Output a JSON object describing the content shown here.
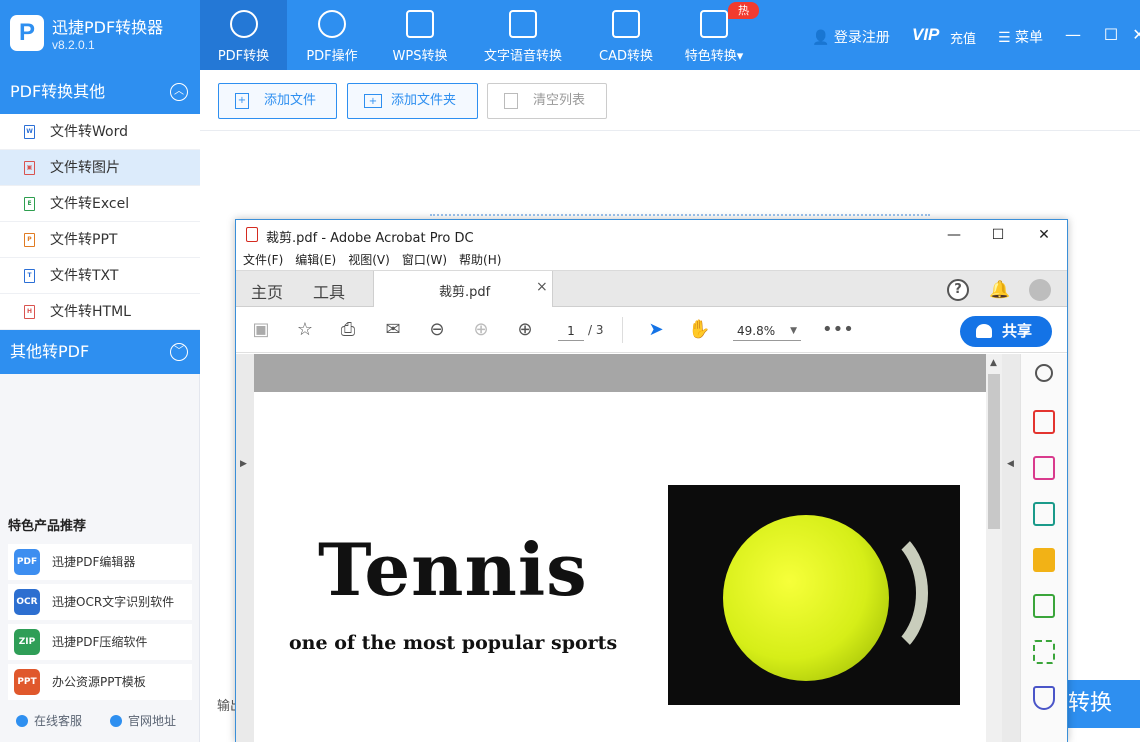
{
  "app": {
    "name": "迅捷PDF转换器",
    "version": "v8.2.0.1",
    "logo_letter": "P"
  },
  "nav": {
    "items": [
      {
        "label": "PDF转换",
        "active": true
      },
      {
        "label": "PDF操作"
      },
      {
        "label": "WPS转换"
      },
      {
        "label": "文字语音转换"
      },
      {
        "label": "CAD转换"
      },
      {
        "label": "特色转换▾"
      }
    ],
    "hot_badge": "热"
  },
  "topright": {
    "login": "登录注册",
    "vip": "VIP",
    "vip_sub": "充值",
    "menu": "菜单",
    "min": "—",
    "max": "☐",
    "close": "✕"
  },
  "sidebar": {
    "section1": "PDF转换其他",
    "items": [
      {
        "label": "文件转Word",
        "icon": "W",
        "color": "#2b6fd6"
      },
      {
        "label": "文件转图片",
        "icon": "▣",
        "color": "#d9534f",
        "selected": true
      },
      {
        "label": "文件转Excel",
        "icon": "E",
        "color": "#2e9e4f"
      },
      {
        "label": "文件转PPT",
        "icon": "P",
        "color": "#e07b22"
      },
      {
        "label": "文件转TXT",
        "icon": "T",
        "color": "#2b6fd6"
      },
      {
        "label": "文件转HTML",
        "icon": "H",
        "color": "#d9534f"
      }
    ],
    "section2": "其他转PDF",
    "promo_title": "特色产品推荐",
    "promos": [
      {
        "label": "迅捷PDF编辑器",
        "icon": "PDF",
        "color": "#3d8ef0"
      },
      {
        "label": "迅捷OCR文字识别软件",
        "icon": "OCR",
        "color": "#2d6fd0"
      },
      {
        "label": "迅捷PDF压缩软件",
        "icon": "ZIP",
        "color": "#2f9e57"
      },
      {
        "label": "办公资源PPT模板",
        "icon": "PPT",
        "color": "#e0582c"
      }
    ],
    "footer": {
      "service": "在线客服",
      "website": "官网地址"
    }
  },
  "toolbar": {
    "add_file": "添加文件",
    "add_folder": "添加文件夹",
    "clear": "清空列表"
  },
  "main": {
    "output_label": "输出",
    "convert": "转换"
  },
  "acrobat": {
    "title": "裁剪.pdf - Adobe Acrobat Pro DC",
    "menu": [
      "文件(F)",
      "编辑(E)",
      "视图(V)",
      "窗口(W)",
      "帮助(H)"
    ],
    "tabs": {
      "home": "主页",
      "tools": "工具",
      "file": "裁剪.pdf",
      "close": "×"
    },
    "page_current": "1",
    "page_total": "/ 3",
    "zoom": "49.8%",
    "share": "共享",
    "help": "?",
    "doc": {
      "title": "Tennis",
      "subtitle": "one of the most popular sports"
    }
  }
}
